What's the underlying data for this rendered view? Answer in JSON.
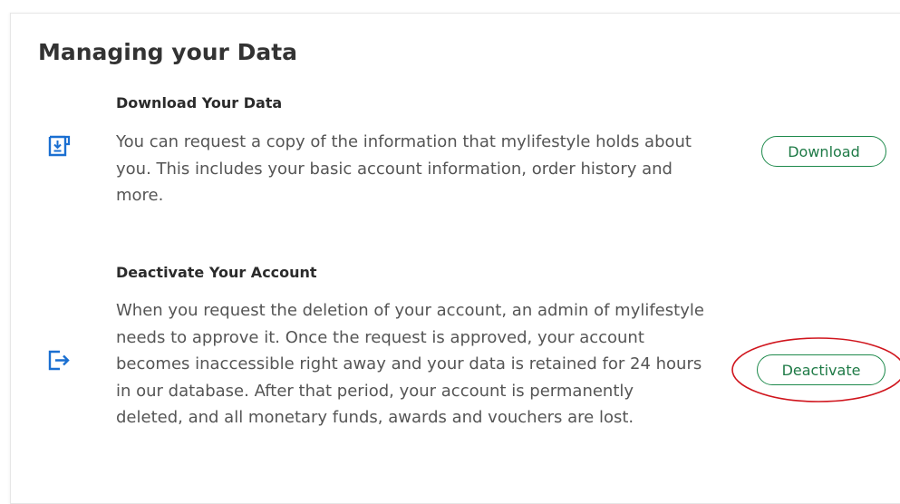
{
  "page": {
    "title": "Managing your Data"
  },
  "sections": [
    {
      "heading": "Download Your Data",
      "description": "You can request a copy of the information that mylifestyle holds about you. This includes your basic account information, order history and more.",
      "button_label": "Download",
      "icon": "download-icon"
    },
    {
      "heading": "Deactivate Your Account",
      "description": "When you request the deletion of your account, an admin of mylifestyle needs to approve it. Once the request is approved, your account becomes inaccessible right away and your data is retained for 24 hours in our database. After that period, your account is permanently deleted, and all monetary funds, awards and vouchers are lost.",
      "button_label": "Deactivate",
      "icon": "sign-out-icon"
    }
  ],
  "colors": {
    "icon_blue": "#1a6fd1",
    "button_green": "#1e8a4c",
    "annotation_red": "#d0151d"
  }
}
